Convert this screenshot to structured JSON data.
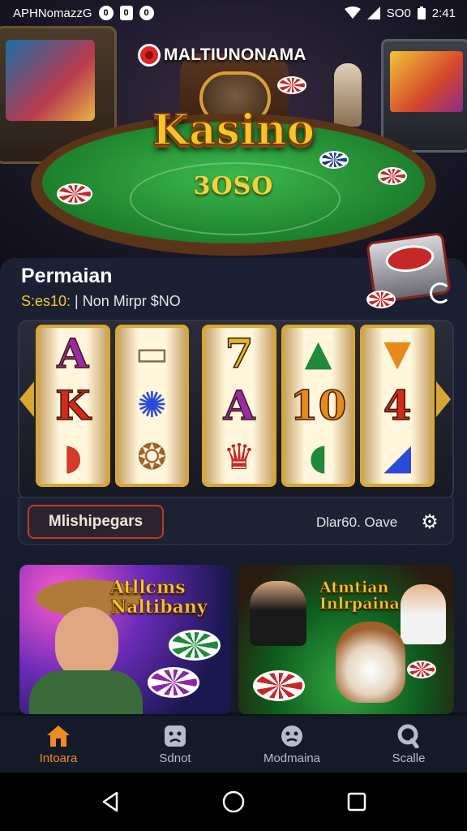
{
  "status_bar": {
    "app_text": "APHNomazzG",
    "badge_1": "0",
    "badge_2": "0",
    "signal_text": "SO0",
    "time": "2:41"
  },
  "hero": {
    "brand": "MALTIUNONAMA",
    "title": "Kasino",
    "amount": "3OSO"
  },
  "section": {
    "title": "Permaian",
    "subtitle_highlight": "S:es10:",
    "subtitle_rest": " | Non Mirpr $NO"
  },
  "slot": {
    "reels": [
      [
        "A",
        "K",
        "◗"
      ],
      [
        "▭",
        "✺",
        "❂"
      ],
      [
        "7",
        "A",
        "♛"
      ],
      [
        "▲",
        "10",
        "◖"
      ],
      [
        "▼",
        "4",
        "◢"
      ]
    ],
    "reel_colors": [
      [
        "#9a2aa8",
        "#d42a1a",
        "#d43a2a"
      ],
      [
        "#8a6a4a",
        "#2a4ad8",
        "#a0602c"
      ],
      [
        "#e8b820",
        "#9a2aa8",
        "#c62828"
      ],
      [
        "#1e8a3a",
        "#e88a1a",
        "#1e8a3a"
      ],
      [
        "#e88a1a",
        "#d42a1a",
        "#2a4ad8"
      ]
    ],
    "multi_button": "Mlishipegars",
    "status": "Dlar60. Oave"
  },
  "promos": {
    "left_title_1": "Atllcms",
    "left_title_2": "Naltibany",
    "right_title_1": "Atmtian",
    "right_title_2": "Inlrpaina"
  },
  "bottom_nav": [
    {
      "label": "Intoara",
      "icon": "home-icon"
    },
    {
      "label": "Sdnot",
      "icon": "face-icon"
    },
    {
      "label": "Modmaina",
      "icon": "smiley-icon"
    },
    {
      "label": "Scalle",
      "icon": "search-icon"
    }
  ],
  "colors": {
    "accent": "#f08a24",
    "gold": "#f5c62a",
    "panel": "#1b2133"
  }
}
